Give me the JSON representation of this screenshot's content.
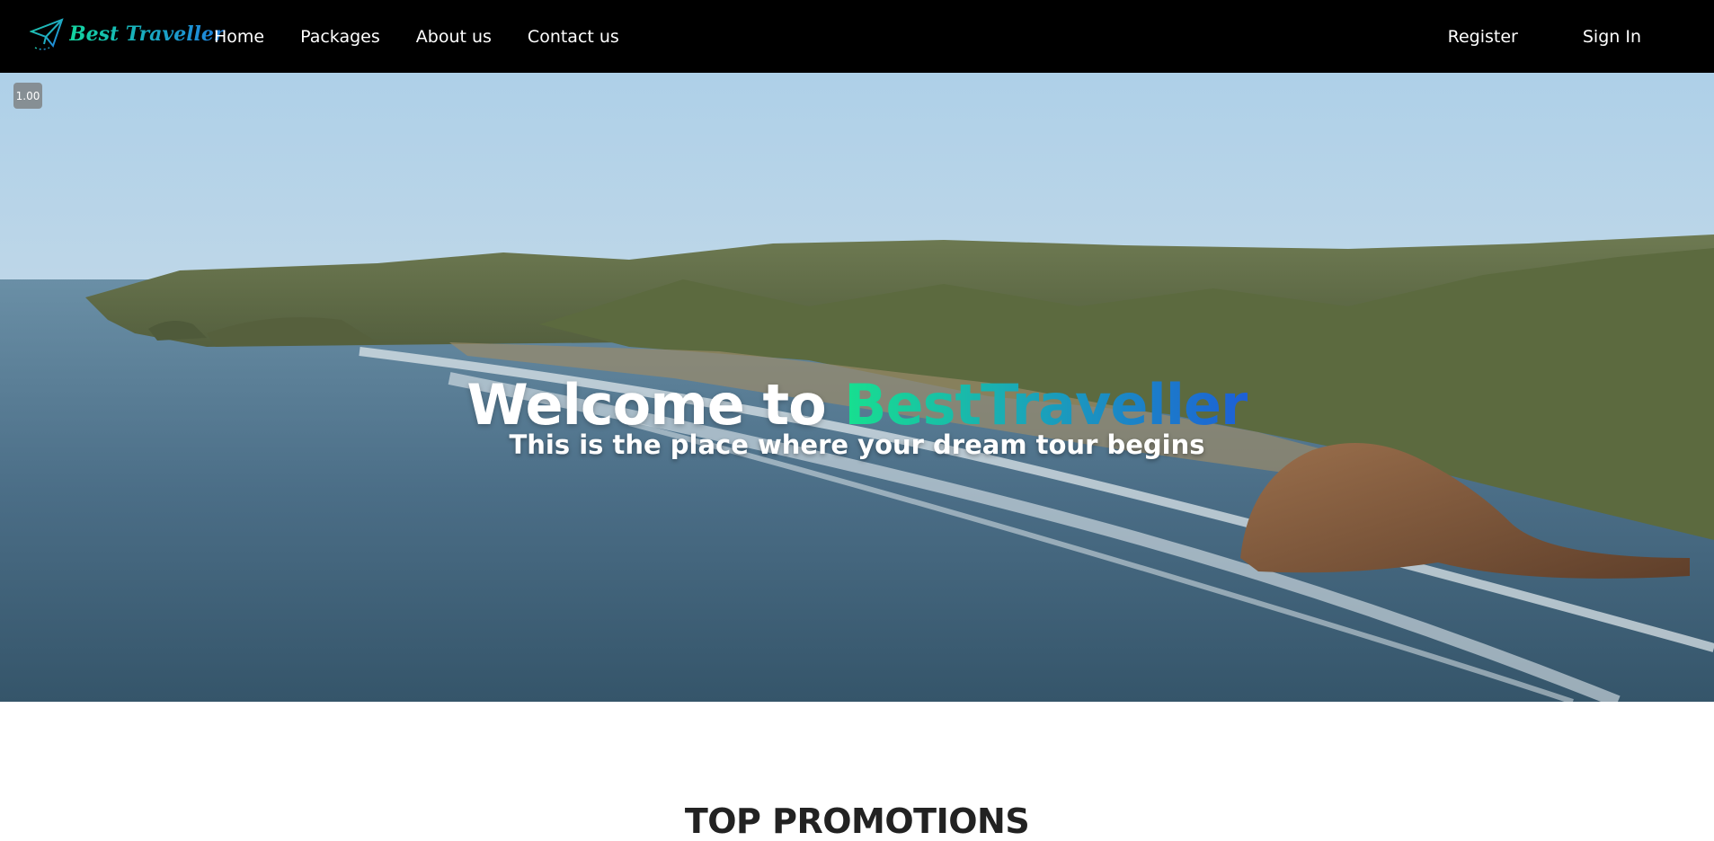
{
  "navbar": {
    "brand": {
      "text": "Best Traveller",
      "icon": "paper-plane-icon"
    },
    "links": [
      "Home",
      "Packages",
      "About us",
      "Contact us"
    ],
    "register_label": "Register",
    "signin_label": "Sign In"
  },
  "zoom_badge": "1.00",
  "hero": {
    "title_prefix": "Welcome to ",
    "title_brand": "BestTraveller",
    "subtitle": "This is the place where your dream tour begins"
  },
  "promotions": {
    "title": "TOP PROMOTIONS"
  },
  "colors": {
    "navbar_bg": "#000000",
    "brand_gradient_start": "#17e08f",
    "brand_gradient_end": "#1d5fd6",
    "heading_dark": "#222222"
  }
}
